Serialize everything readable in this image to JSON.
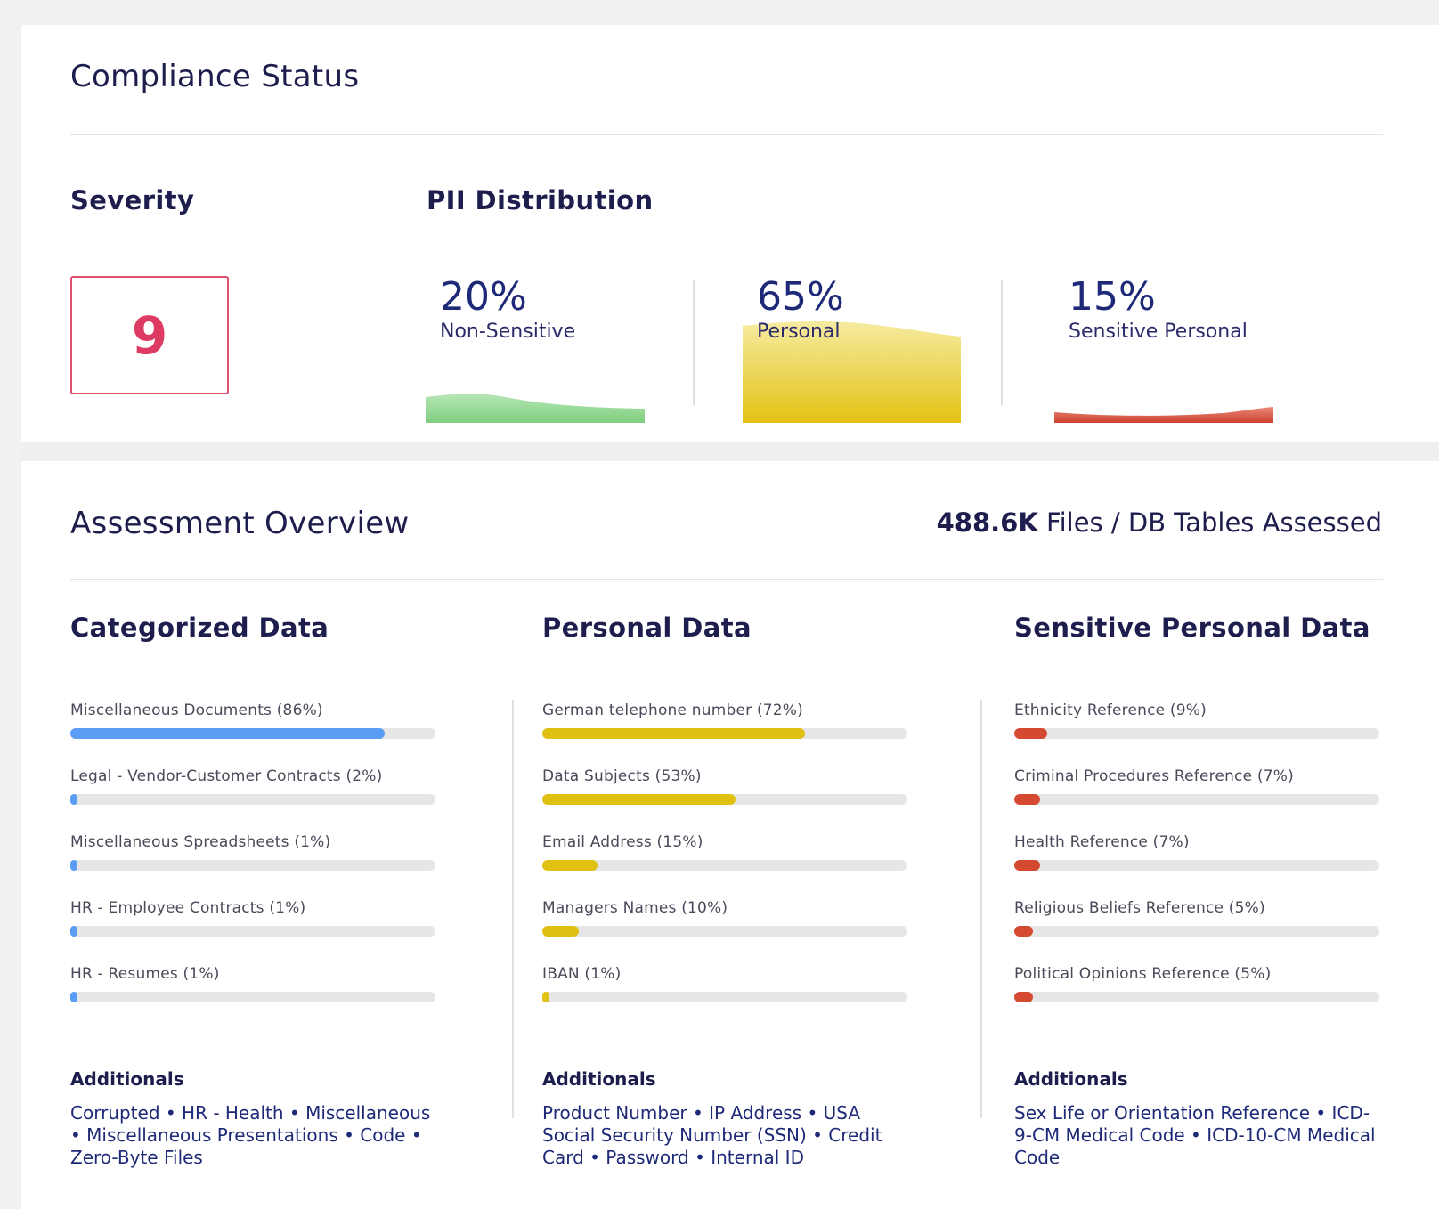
{
  "compliance": {
    "title": "Compliance Status",
    "severity": {
      "heading": "Severity",
      "value": "9"
    },
    "pii": {
      "heading": "PII Distribution",
      "items": [
        {
          "percent": "20%",
          "label": "Non-Sensitive",
          "color": "#7fce7f"
        },
        {
          "percent": "65%",
          "label": "Personal",
          "color": "#e6c200"
        },
        {
          "percent": "15%",
          "label": "Sensitive Personal",
          "color": "#d4503a"
        }
      ]
    }
  },
  "assessment": {
    "title": "Assessment Overview",
    "files_count": "488.6K",
    "files_suffix": " Files / DB Tables Assessed",
    "columns": [
      {
        "title": "Categorized Data",
        "color": "#5b9df5",
        "bars": [
          {
            "label": "Miscellaneous Documents (86%)",
            "value": 86
          },
          {
            "label": "Legal - Vendor-Customer Contracts (2%)",
            "value": 2
          },
          {
            "label": "Miscellaneous Spreadsheets (1%)",
            "value": 1
          },
          {
            "label": "HR - Employee Contracts (1%)",
            "value": 1
          },
          {
            "label": "HR - Resumes (1%)",
            "value": 1
          }
        ],
        "additionals_title": "Additionals",
        "additionals_text": "Corrupted • HR - Health • Miscellaneous • Miscellaneous Presentations • Code • Zero-Byte Files"
      },
      {
        "title": "Personal Data",
        "color": "#e0c010",
        "bars": [
          {
            "label": "German telephone number (72%)",
            "value": 72
          },
          {
            "label": "Data Subjects (53%)",
            "value": 53
          },
          {
            "label": "Email Address (15%)",
            "value": 15
          },
          {
            "label": "Managers Names (10%)",
            "value": 10
          },
          {
            "label": "IBAN (1%)",
            "value": 1
          }
        ],
        "additionals_title": "Additionals",
        "additionals_text": "Product Number • IP Address • USA Social Security Number (SSN) • Credit Card • Password • Internal ID"
      },
      {
        "title": "Sensitive Personal Data",
        "color": "#d44a30",
        "bars": [
          {
            "label": "Ethnicity Reference (9%)",
            "value": 9
          },
          {
            "label": "Criminal Procedures Reference (7%)",
            "value": 7
          },
          {
            "label": "Health Reference (7%)",
            "value": 7
          },
          {
            "label": "Religious Beliefs Reference (5%)",
            "value": 5
          },
          {
            "label": "Political Opinions Reference (5%)",
            "value": 5
          }
        ],
        "additionals_title": "Additionals",
        "additionals_text": "Sex Life or Orientation Reference • ICD-9-CM Medical Code • ICD-10-CM Medical Code"
      }
    ]
  }
}
